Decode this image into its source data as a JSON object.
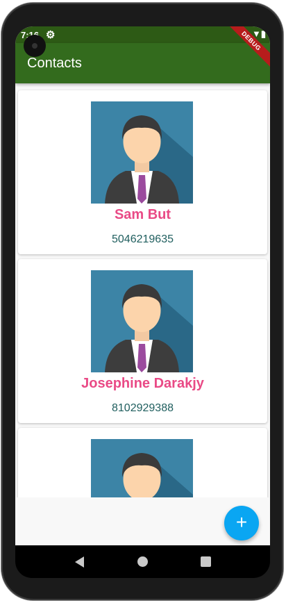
{
  "status_bar": {
    "time": "7:16"
  },
  "app_bar": {
    "title": "Contacts"
  },
  "debug_banner": "DEBUG",
  "contacts": [
    {
      "name": "Sam But",
      "phone": "5046219635"
    },
    {
      "name": "Josephine Darakjy",
      "phone": "8102929388"
    },
    {
      "name": "",
      "phone": ""
    }
  ],
  "fab": {
    "icon": "add-icon",
    "label": "+"
  },
  "colors": {
    "app_bar": "#336b1d",
    "status_bar": "#2d5a15",
    "name": "#e94a86",
    "phone": "#1f5e5e",
    "fab": "#0aa6f2"
  }
}
